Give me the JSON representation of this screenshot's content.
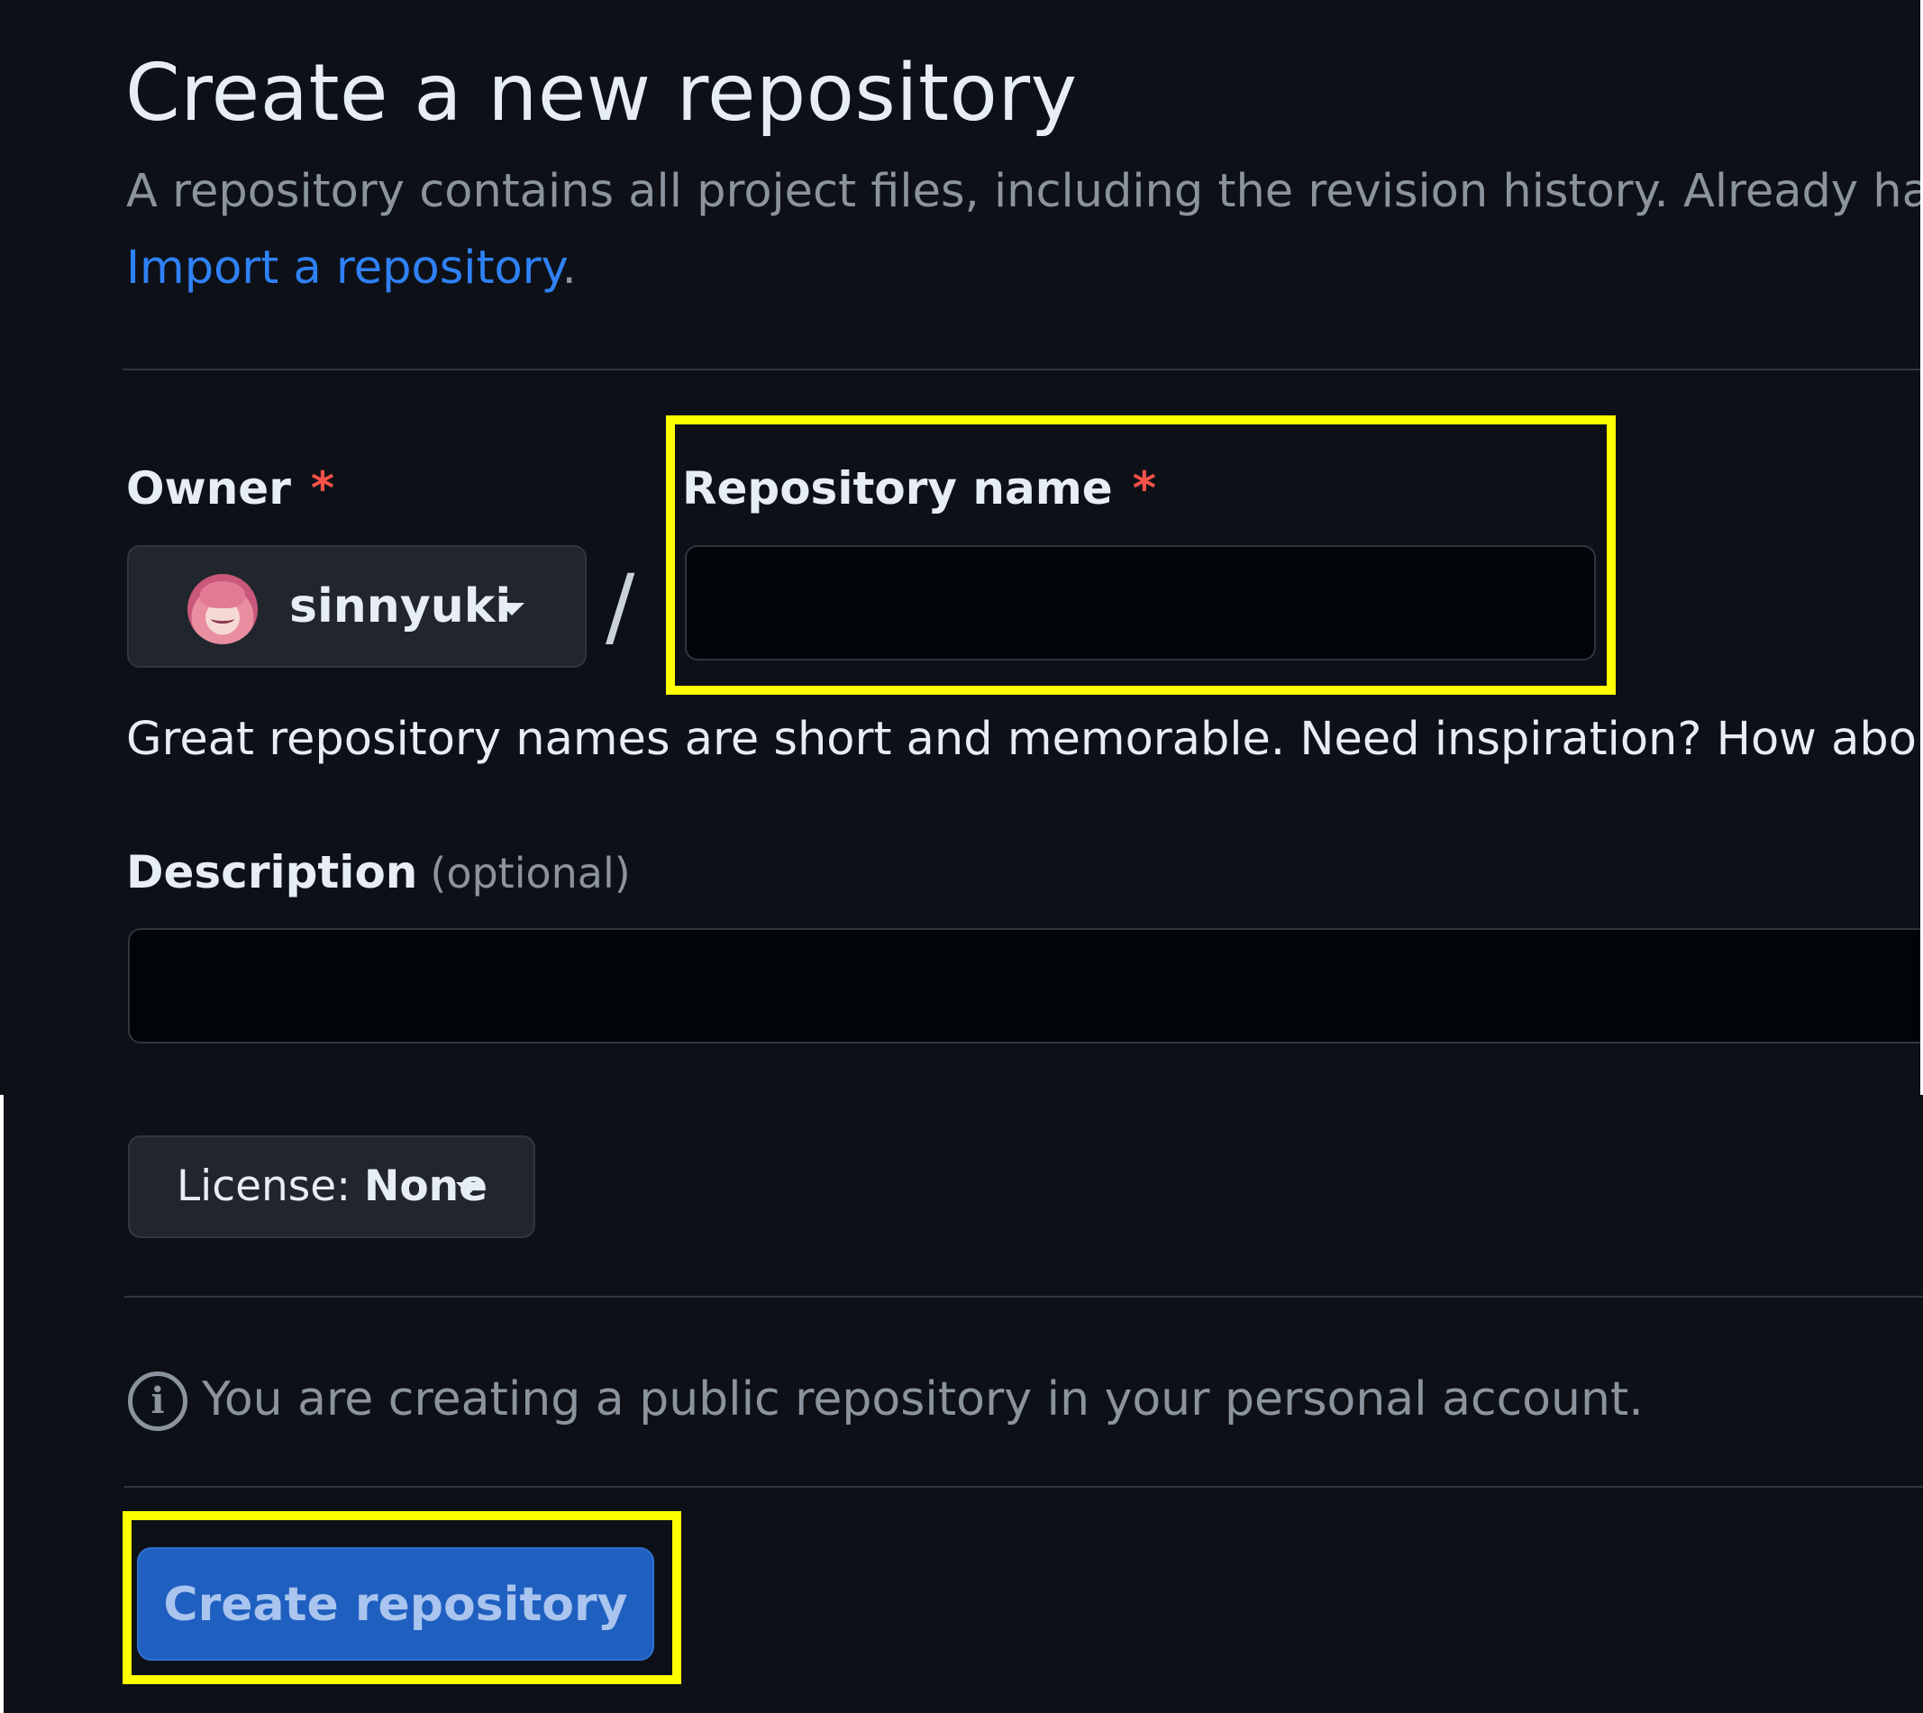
{
  "page": {
    "title": "Create a new repository",
    "subtitle": "A repository contains all project files, including the revision history. Already have",
    "import_link": "Import a repository",
    "import_link_period": "."
  },
  "owner": {
    "label": "Owner",
    "required_mark": "*",
    "value": "sinnyuki",
    "avatar_icon": "user-avatar-icon"
  },
  "separator": "/",
  "repository_name": {
    "label": "Repository name",
    "required_mark": "*",
    "value": "",
    "hint": "Great repository names are short and memorable. Need inspiration? How about"
  },
  "description": {
    "label": "Description",
    "optional_label": "(optional)",
    "value": ""
  },
  "license": {
    "prefix": "License:",
    "value": "None"
  },
  "notice": {
    "icon": "info-icon",
    "text": "You are creating a public repository in your personal account."
  },
  "actions": {
    "create_label": "Create repository"
  },
  "colors": {
    "background": "#0d1117",
    "text": "#e6edf3",
    "muted": "#8b949e",
    "link": "#2f81f7",
    "required": "#f85149",
    "primary_button": "#1f5fbf",
    "highlight": "#ffff00"
  }
}
